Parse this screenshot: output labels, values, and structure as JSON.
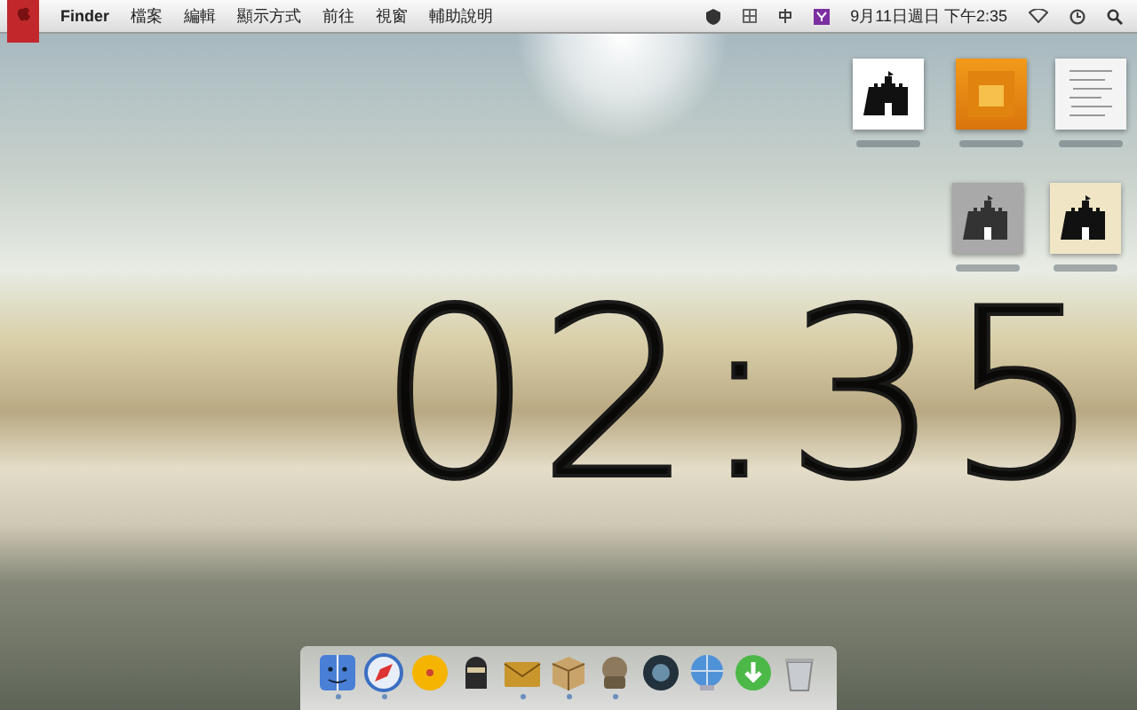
{
  "menu_bar": {
    "app": "Finder",
    "items": [
      "檔案",
      "編輯",
      "顯示方式",
      "前往",
      "視窗",
      "輔助說明"
    ],
    "status": {
      "date_time": "9月11日週日 下午2:35"
    }
  },
  "desktop_files": [
    {
      "kind": "castle-white"
    },
    {
      "kind": "ai"
    },
    {
      "kind": "sketch"
    },
    {
      "kind": "castle-gray"
    },
    {
      "kind": "castle-cream"
    }
  ],
  "clock": "02:35",
  "dock": [
    {
      "kind": "finder",
      "running": true
    },
    {
      "kind": "safari",
      "running": true
    },
    {
      "kind": "ball",
      "running": false
    },
    {
      "kind": "ninja",
      "running": false
    },
    {
      "kind": "mail",
      "running": true
    },
    {
      "kind": "box",
      "running": true
    },
    {
      "kind": "robot",
      "running": true
    },
    {
      "kind": "camera",
      "running": false
    },
    {
      "kind": "globe",
      "running": false
    },
    {
      "kind": "download",
      "running": false
    },
    {
      "kind": "trash",
      "running": false
    }
  ]
}
